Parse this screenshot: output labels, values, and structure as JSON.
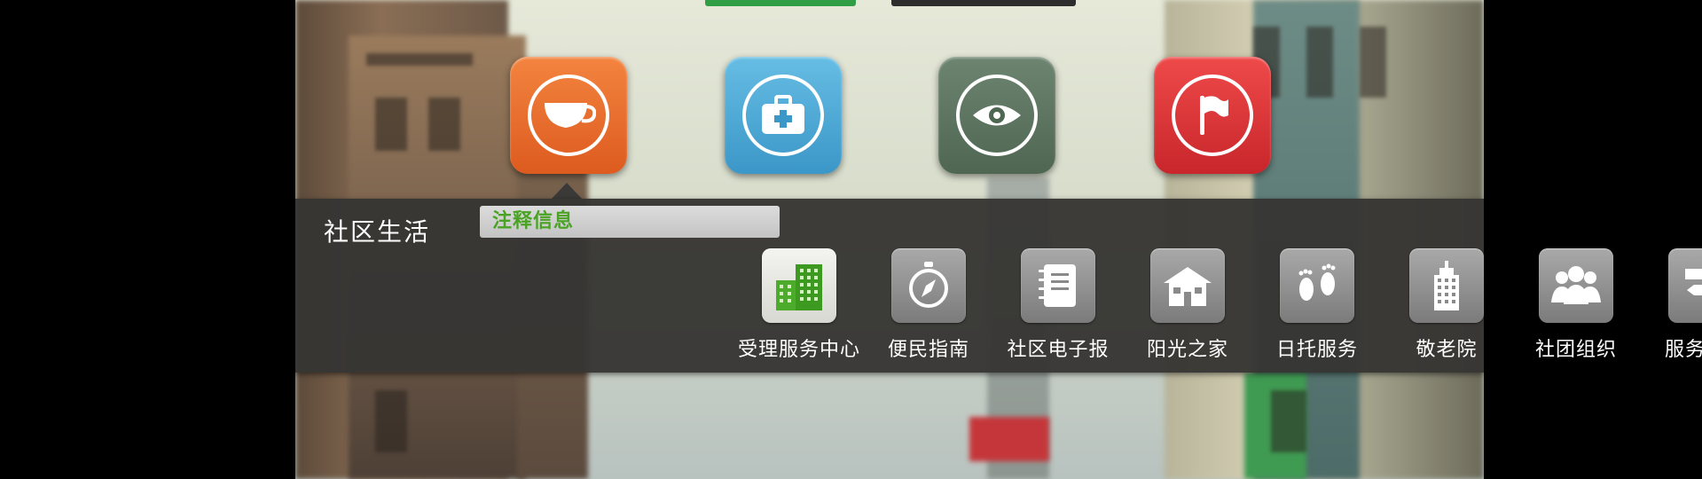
{
  "colors": {
    "panel_bg": "#363533",
    "tooltip_text": "#4aa324",
    "tile_orange": "#e96a2a",
    "tile_blue": "#4aa8d6",
    "tile_green": "#5d7560",
    "tile_red": "#dc3537",
    "tab_active": "#2f9e44"
  },
  "categories": [
    {
      "icon": "teacup-icon",
      "active": true
    },
    {
      "icon": "medical-kit-icon",
      "active": false
    },
    {
      "icon": "eye-icon",
      "active": false
    },
    {
      "icon": "flag-icon",
      "active": false
    }
  ],
  "panel": {
    "title": "社区生活",
    "tooltip": "注释信息"
  },
  "apps": [
    {
      "label": "受理服务中心",
      "icon": "green-buildings-icon"
    },
    {
      "label": "便民指南",
      "icon": "compass-icon"
    },
    {
      "label": "社区电子报",
      "icon": "notebook-icon"
    },
    {
      "label": "阳光之家",
      "icon": "house-icon"
    },
    {
      "label": "日托服务",
      "icon": "footprints-icon"
    },
    {
      "label": "敬老院",
      "icon": "tall-building-icon"
    },
    {
      "label": "社团组织",
      "icon": "group-people-icon"
    },
    {
      "label": "服务导航",
      "icon": "signpost-icon"
    }
  ]
}
